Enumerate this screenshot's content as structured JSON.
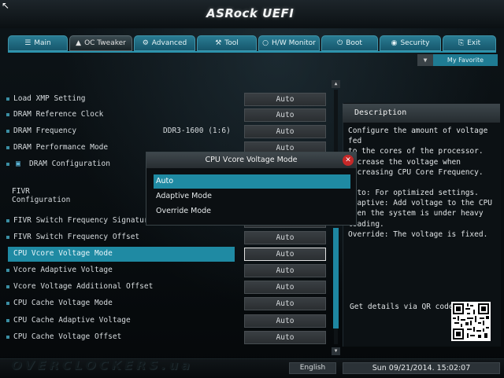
{
  "brand": {
    "logo": "ASRock UEFI"
  },
  "nav": {
    "tabs": [
      {
        "label": "Main",
        "icon": "list-icon"
      },
      {
        "label": "OC Tweaker",
        "icon": "flame-icon",
        "active": true
      },
      {
        "label": "Advanced",
        "icon": "tools-icon"
      },
      {
        "label": "Tool",
        "icon": "wrench-icon"
      },
      {
        "label": "H/W Monitor",
        "icon": "monitor-icon"
      },
      {
        "label": "Boot",
        "icon": "power-icon"
      },
      {
        "label": "Security",
        "icon": "lock-icon"
      },
      {
        "label": "Exit",
        "icon": "exit-icon"
      }
    ],
    "favorite_label": "My Favorite"
  },
  "settings": {
    "rows": [
      {
        "label": "Load XMP Setting",
        "value": "Auto"
      },
      {
        "label": "DRAM Reference Clock",
        "value": "Auto"
      },
      {
        "label": "DRAM Frequency",
        "mid": "DDR3-1600 (1:6)",
        "value": "Auto"
      },
      {
        "label": "DRAM Performance Mode",
        "value": "Auto"
      },
      {
        "label": "DRAM Configuration"
      },
      {
        "section": "FIVR Configuration"
      },
      {
        "label": "FIVR Switch Frequency Signature",
        "value": "Auto"
      },
      {
        "label": "FIVR Switch Frequency Offset",
        "value": "Auto"
      },
      {
        "label": "CPU Vcore Voltage Mode",
        "value": "Auto",
        "selected": true
      },
      {
        "label": "Vcore Adaptive Voltage",
        "value": "Auto"
      },
      {
        "label": "Vcore Voltage Additional Offset",
        "value": "Auto"
      },
      {
        "label": "CPU Cache Voltage Mode",
        "value": "Auto"
      },
      {
        "label": "CPU Cache Adaptive Voltage",
        "value": "Auto"
      },
      {
        "label": "CPU Cache Voltage Offset",
        "value": "Auto"
      }
    ]
  },
  "description": {
    "title": "Description",
    "lines": [
      "Configure the amount of voltage fed",
      "to the cores of the processor.",
      "Increase the voltage when",
      "increasing CPU Core Frequency.",
      "",
      "Auto: For optimized settings.",
      "Adaptive: Add voltage to the CPU",
      "when the system is under heavy",
      "loading.",
      "Override: The voltage is fixed."
    ],
    "qr_text": "Get details via QR code"
  },
  "dialog": {
    "title": "CPU Vcore Voltage Mode",
    "options": [
      "Auto",
      "Adaptive Mode",
      "Override Mode"
    ],
    "selected": "Auto"
  },
  "footer": {
    "watermark": "OVERCLOCKERS.ua",
    "language": "English",
    "datetime": "Sun 09/21/2014. 15:02:07"
  },
  "colors": {
    "accent": "#1f8aa3",
    "close": "#c62828"
  }
}
